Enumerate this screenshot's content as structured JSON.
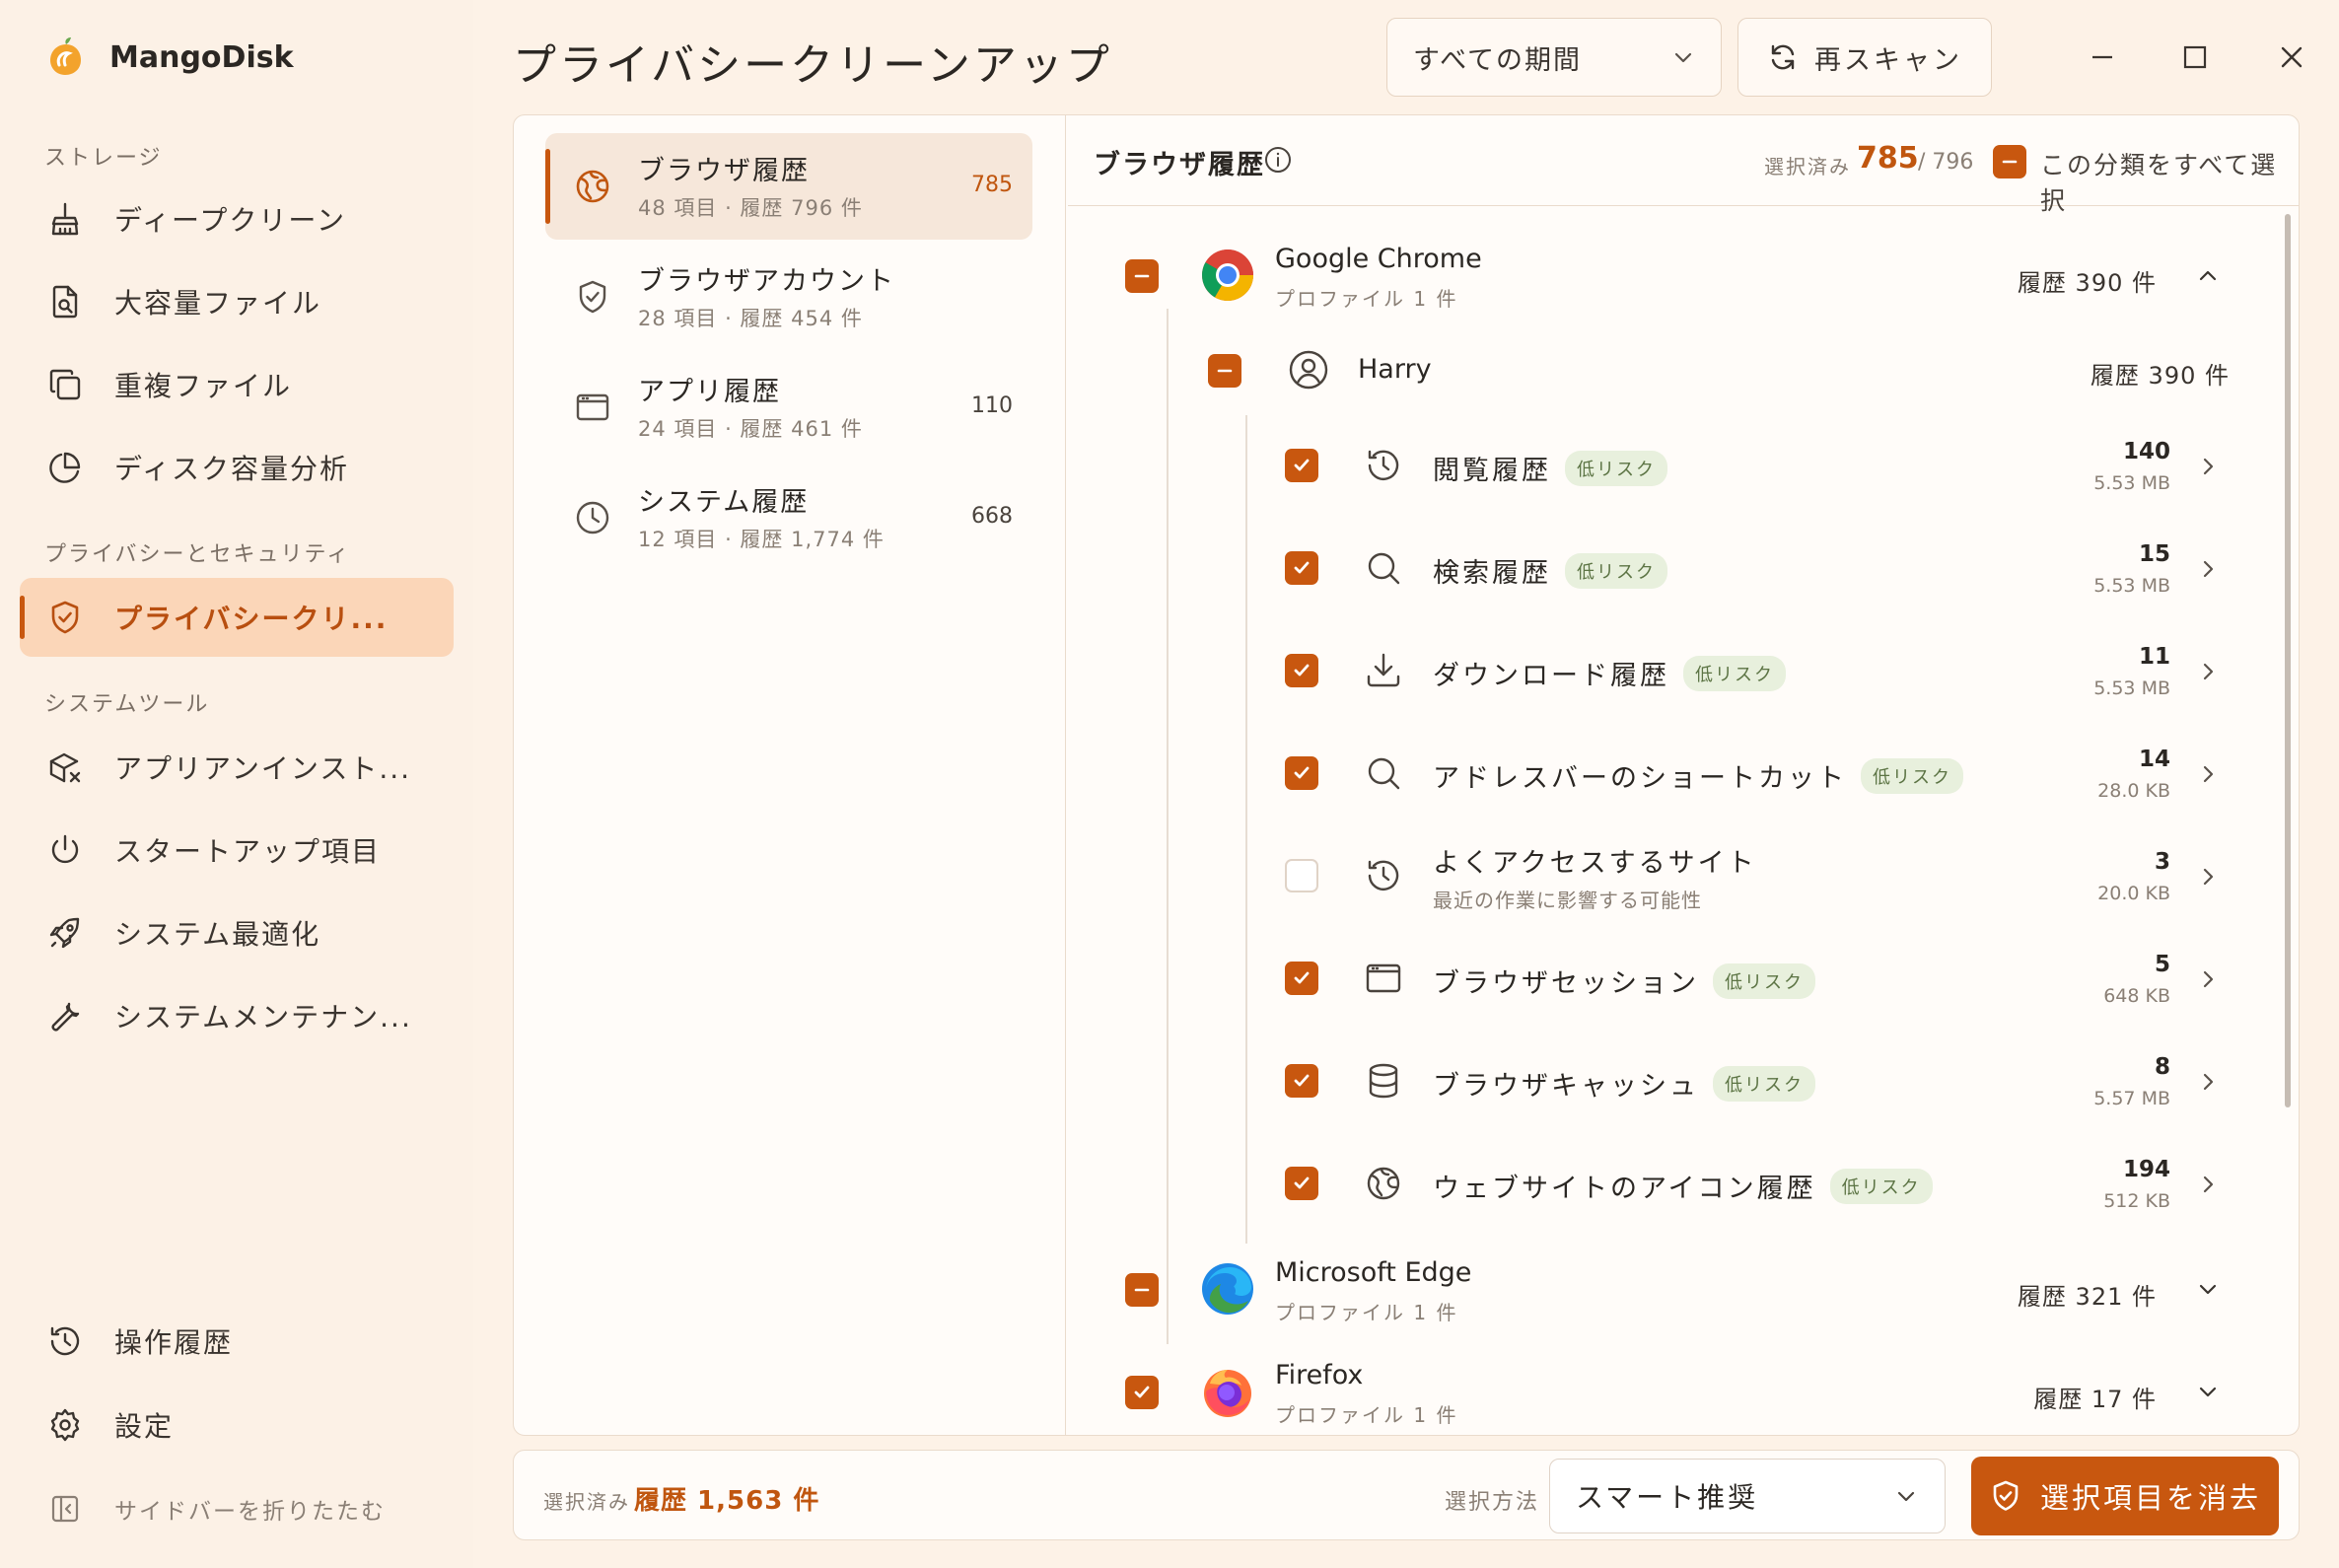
{
  "app": {
    "name": "MangoDisk"
  },
  "sidebar": {
    "sections": {
      "storage": "ストレージ",
      "privacy": "プライバシーとセキュリティ",
      "tools": "システムツール"
    },
    "items": [
      {
        "label": "ディープクリーン",
        "icon": "broom-icon"
      },
      {
        "label": "大容量ファイル",
        "icon": "file-search-icon"
      },
      {
        "label": "重複ファイル",
        "icon": "copy-icon"
      },
      {
        "label": "ディスク容量分析",
        "icon": "pie-chart-icon"
      },
      {
        "label": "プライバシークリ...",
        "icon": "shield-icon",
        "active": true
      },
      {
        "label": "アプリアンインスト...",
        "icon": "package-remove-icon"
      },
      {
        "label": "スタートアップ項目",
        "icon": "power-icon"
      },
      {
        "label": "システム最適化",
        "icon": "rocket-icon"
      },
      {
        "label": "システムメンテナン...",
        "icon": "wrench-icon"
      },
      {
        "label": "操作履歴",
        "icon": "history-icon"
      },
      {
        "label": "設定",
        "icon": "gear-icon"
      }
    ],
    "collapse_label": "サイドバーを折りたたむ"
  },
  "header": {
    "title": "プライバシークリーンアップ",
    "period": "すべての期間",
    "rescan": "再スキャン"
  },
  "categories": [
    {
      "title": "ブラウザ履歴",
      "sub": "48 項目 · 履歴 796 件",
      "count": "785",
      "active": true
    },
    {
      "title": "ブラウザアカウント",
      "sub": "28 項目 · 履歴 454 件",
      "count": ""
    },
    {
      "title": "アプリ履歴",
      "sub": "24 項目 · 履歴 461 件",
      "count": "110"
    },
    {
      "title": "システム履歴",
      "sub": "12 項目 · 履歴 1,774 件",
      "count": "668"
    }
  ],
  "detail": {
    "title": "ブラウザ履歴",
    "selected_label": "選択済み",
    "selected_num": "785",
    "selected_total": "/ 796",
    "select_all": "この分類をすべて選択",
    "browsers": [
      {
        "name": "Google Chrome",
        "sub": "プロファイル 1 件",
        "total": "履歴 390 件"
      },
      {
        "name": "Microsoft Edge",
        "sub": "プロファイル 1 件",
        "total": "履歴 321 件"
      },
      {
        "name": "Firefox",
        "sub": "プロファイル 1 件",
        "total": "履歴 17 件"
      }
    ],
    "profile": {
      "name": "Harry",
      "total": "履歴 390 件"
    },
    "items": [
      {
        "name": "閲覧履歴",
        "badge": "低リスク",
        "count": "140",
        "size": "5.53 MB",
        "checked": true,
        "icon": "history-icon"
      },
      {
        "name": "検索履歴",
        "badge": "低リスク",
        "count": "15",
        "size": "5.53 MB",
        "checked": true,
        "icon": "search-icon"
      },
      {
        "name": "ダウンロード履歴",
        "badge": "低リスク",
        "count": "11",
        "size": "5.53 MB",
        "checked": true,
        "icon": "download-icon"
      },
      {
        "name": "アドレスバーのショートカット",
        "badge": "低リスク",
        "count": "14",
        "size": "28.0 KB",
        "checked": true,
        "icon": "search-icon"
      },
      {
        "name": "よくアクセスするサイト",
        "sub": "最近の作業に影響する可能性",
        "count": "3",
        "size": "20.0 KB",
        "checked": false,
        "icon": "history-icon"
      },
      {
        "name": "ブラウザセッション",
        "badge": "低リスク",
        "count": "5",
        "size": "648 KB",
        "checked": true,
        "icon": "window-icon"
      },
      {
        "name": "ブラウザキャッシュ",
        "badge": "低リスク",
        "count": "8",
        "size": "5.57 MB",
        "checked": true,
        "icon": "database-icon"
      },
      {
        "name": "ウェブサイトのアイコン履歴",
        "badge": "低リスク",
        "count": "194",
        "size": "512 KB",
        "checked": true,
        "icon": "globe-icon"
      }
    ]
  },
  "footer": {
    "selected_label": "選択済み",
    "selected_value": "履歴 1,563 件",
    "method_label": "選択方法",
    "method_value": "スマート推奨",
    "clean_button": "選択項目を消去"
  },
  "colors": {
    "accent": "#c8570f",
    "sidebar_bg": "#fcf1e6",
    "badge_bg": "#e8f0dd"
  }
}
